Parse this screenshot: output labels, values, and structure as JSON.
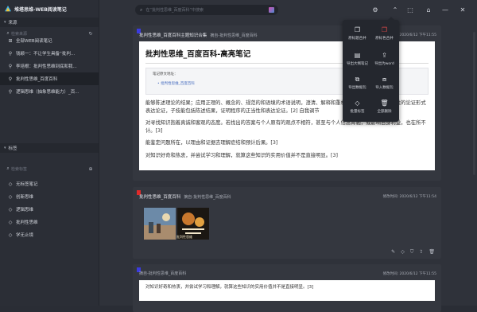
{
  "app": {
    "title": "堆塔思维-WEB阅读笔记"
  },
  "sidebar": {
    "source_header": "来源",
    "source_search_placeholder": "检索来源",
    "sources": [
      {
        "label": "全部WEB阅读笔记",
        "icon": "grid-icon"
      },
      {
        "label": "钱颖一：不让学生具备“批判...",
        "icon": "link-icon"
      },
      {
        "label": "李培根：批判性思维到底和我...",
        "icon": "link-icon"
      },
      {
        "label": "批判性思维_百度百科",
        "icon": "link-icon",
        "active": true
      },
      {
        "label": "逻辑思维（抽象思维能力）_百...",
        "icon": "link-icon"
      }
    ],
    "tag_header": "标签",
    "tag_search_placeholder": "检索标签",
    "tags": [
      {
        "label": "无标签笔记",
        "icon": "tag-icon"
      },
      {
        "label": "创新思维",
        "icon": "tag-icon"
      },
      {
        "label": "逻辑思维",
        "icon": "tag-icon"
      },
      {
        "label": "批判性思维",
        "icon": "tag-icon"
      },
      {
        "label": "学无止境",
        "icon": "tag-icon"
      }
    ]
  },
  "topbar": {
    "search_placeholder": "在“批判性思维_百度百科”中搜索"
  },
  "cards": [
    {
      "flag_color": "#3b3be0",
      "title": "批判性思维_百度百科主题知识合集",
      "subtitle": "摘自-批判性思维_百度百科",
      "date": "修改时间: 2020/6/12 下午11:55",
      "doc": {
        "heading": "批判性思维_百度百科-高亮笔记",
        "source_label": "笔记原文地址：",
        "source_link": "批判性思维_百度百科",
        "paragraphs": [
          "能够陈述理论的结果；应用正理的、概念的、规范的和语境的术语说明，澄清、解释和重构思维的，可以作出结论性的论证形式表达论证，子技能包括陈述结果，证明程序的正当性和表达论证。[2] 自我调节",
          "对寻找知识抱着真诚和客观的态度。若找出的答案与个人原有的观点不相符，甚至与个人信念背驰，或影响自身利益，也在所不计。[3]",
          "能鉴定问题所在，以理由和证据去理解症结和预计后果。[3]",
          "对知识好奇和热衷，并尝试学习和理解，就算这些知识的实用价值并不是直接明显。[3]"
        ]
      }
    },
    {
      "flag_color": "#e02a2a",
      "title": "批判性思维_百度百科",
      "subtitle": "摘自-批判性思维_百度百科",
      "date": "修改时间: 2020/6/12 下午11:54",
      "image_caption": "批判性思维"
    },
    {
      "flag_color": "#3b3be0",
      "subtitle": "摘自-批判性思维_百度百科",
      "date": "修改时间: 2020/6/12 下午11:55",
      "text": "对知识好奇和热衷，并尝试学习和理解，就算这些知识的实用价值并不是直接明显。[3]"
    }
  ],
  "menu": {
    "items": [
      {
        "label": "原标题合并",
        "icon": "copy-icon"
      },
      {
        "label": "原标色合并",
        "icon": "copy-red-icon",
        "red": true
      },
      {
        "label": "导出大纲笔记",
        "icon": "doc-export-icon"
      },
      {
        "label": "导出为word",
        "icon": "share-export-icon"
      },
      {
        "label": "导出数据包",
        "icon": "package-export-icon"
      },
      {
        "label": "导入数据包",
        "icon": "package-import-icon"
      },
      {
        "label": "批量标签",
        "icon": "tag-icon"
      },
      {
        "label": "全部删除",
        "icon": "trash-icon"
      }
    ]
  },
  "colors": {
    "accent_red": "#e44a4a",
    "accent_blue": "#3b3be0",
    "bg": "#2f323a"
  }
}
